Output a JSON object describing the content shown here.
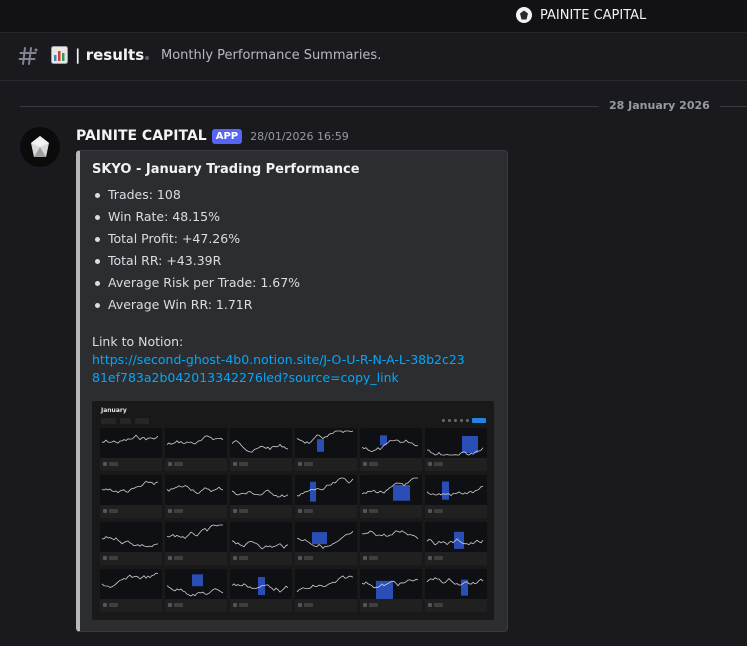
{
  "topbar": {
    "server_name": "PAINITE CAPITAL"
  },
  "channel": {
    "name": "| results",
    "topic": "Monthly Performance Summaries."
  },
  "divider": {
    "date": "28 January 2026"
  },
  "message": {
    "author": "PAINITE CAPITAL",
    "badge": "APP",
    "timestamp": "28/01/2026 16:59",
    "embed": {
      "title": "SKYO - January Trading Performance",
      "stats": [
        "Trades: 108",
        "Win Rate: 48.15%",
        "Total Profit: +47.26%",
        "Total RR: +43.39R",
        "Average Risk per Trade: 1.67%",
        "Average Win RR: 1.71R"
      ],
      "link_label": "Link to Notion:",
      "link_url": "https://second-ghost-4b0.notion.site/J-O-U-R-N-A-L-38b2c2381ef783a2b042013342276led?source=copy_link",
      "image": {
        "title": "January"
      }
    }
  },
  "colors": {
    "background": "#1a1a1e",
    "embed_bg": "#2b2d31",
    "embed_border": "#b9b9b9",
    "link": "#00a8fc",
    "badge": "#5865f2"
  },
  "icons": {
    "hash": "hash-icon",
    "channel_emoji": "bar-chart-icon",
    "server": "painite-gem-icon"
  }
}
